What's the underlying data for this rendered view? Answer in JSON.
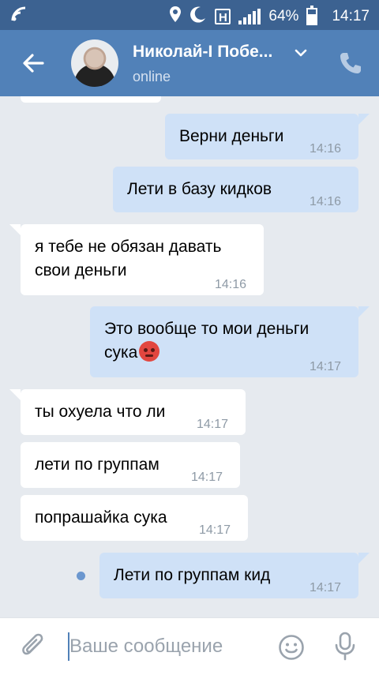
{
  "status_bar": {
    "battery": "64%",
    "time": "14:17",
    "network_badge": "H"
  },
  "header": {
    "contact_name": "Николай-I Побе...",
    "contact_status": "online"
  },
  "messages": [
    {
      "direction": "out",
      "text": "Верни деньги",
      "time": "14:16"
    },
    {
      "direction": "out",
      "text": "Лети в базу кидков",
      "time": "14:16"
    },
    {
      "direction": "in",
      "text_line1": "я тебе не обязан давать",
      "text_line2": "свои деньги",
      "time": "14:16"
    },
    {
      "direction": "out",
      "text_line1": "Это вообще то мои деньги",
      "text_line2": "сука",
      "emoji": "angry-face",
      "time": "14:17"
    },
    {
      "direction": "in",
      "text": "ты охуела что ли",
      "time": "14:17"
    },
    {
      "direction": "in",
      "text": "лети по группам",
      "time": "14:17"
    },
    {
      "direction": "in",
      "text": "попрашайка сука",
      "time": "14:17"
    },
    {
      "direction": "out",
      "text": "Лети по группам кид",
      "time": "14:17",
      "unread": true
    }
  ],
  "input": {
    "placeholder": "Ваше сообщение",
    "value": ""
  },
  "icons": [
    "wifi-icon",
    "location-icon",
    "moon-icon",
    "signal-icon",
    "battery-icon",
    "back-arrow-icon",
    "chevron-down-icon",
    "phone-icon",
    "attach-icon",
    "smile-icon",
    "mic-icon"
  ],
  "colors": {
    "status_bar": "#3c6291",
    "header": "#5181b8",
    "chat_background": "#e6eaef",
    "incoming_bubble": "#ffffff",
    "outgoing_bubble": "#cfe1f7",
    "unread_dot": "#6b97cf"
  }
}
